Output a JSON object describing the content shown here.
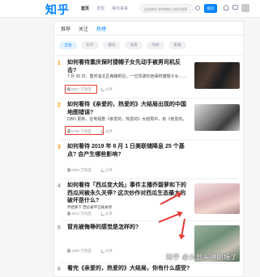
{
  "header": {
    "logo": "知乎",
    "nav": [
      "首页",
      "发现",
      "等你来答"
    ],
    "search_placeholder": "宏观博弈 转转博弈小群你我探",
    "ask_label": "提问"
  },
  "tabs": [
    "推荐",
    "关注",
    "热榜"
  ],
  "chips": [
    "全站",
    "科学",
    "数码",
    "体育",
    "时尚",
    "影视"
  ],
  "items": [
    {
      "rank": "1",
      "title": "如何看待重庆保时捷帽子女先动手被男司机反击?",
      "excerpt": "7 月 30 日，重庆渝北区两路附近，一位驾驶红色保时捷帽子女……",
      "metric": "6057 万热度",
      "share": "分享"
    },
    {
      "rank": "2",
      "title": "如何看待《亲爱的，热爱的》大结局出现的中国地图错误?",
      "excerpt": "DBO 更新，在电视剧《亲爱的，热爱的》大结局中，有《亲爱的，",
      "metric": "5766 万热度",
      "share": "分享"
    },
    {
      "rank": "3",
      "title": "如何看待 2019 年 8 月 1 日美联储降息 25 个基点? 会产生哪些影响?",
      "metric": "5384 万热度",
      "share": "分享"
    },
    {
      "rank": "4",
      "title": "如何看待「西瓜变大妈」事件主播乔碧萝和下的西瓜间被永久关停? 这次炒作对西瓜生态最大的破坏是什么?",
      "excerpt": "乔碧萝下 西瓜被平已被关停",
      "metric": "4870 万热度",
      "share": "分享"
    },
    {
      "rank": "5",
      "title": "冒充被侮辱的感觉是怎样的?",
      "metric": "3480 万热度",
      "share": "分享"
    },
    {
      "rank": "6",
      "title": "看完《亲爱的，热爱的》大结局，你有什么感受?"
    }
  ],
  "watermark": "知乎 @大部头讲职场了",
  "colors": {
    "brand": "#0084ff",
    "annotation": "#e53935",
    "rank_hot": "#ff9607"
  }
}
